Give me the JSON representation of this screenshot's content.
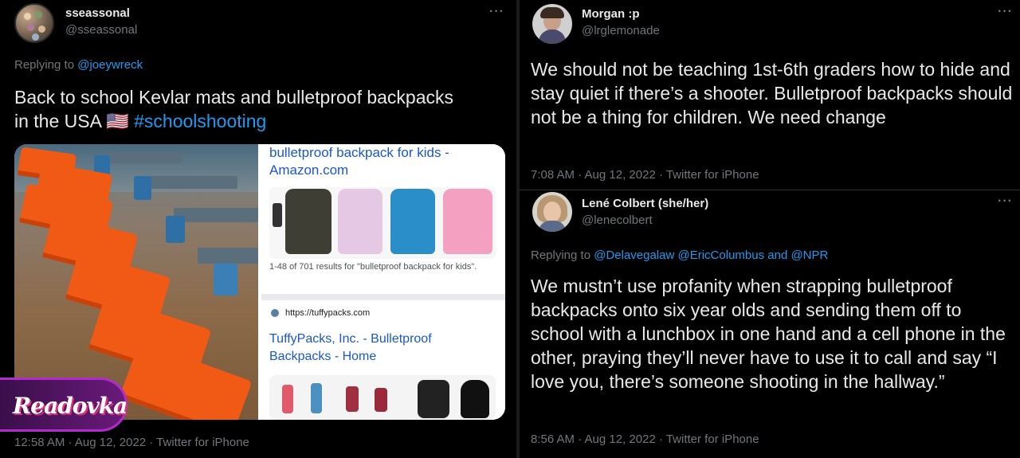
{
  "left_tweet": {
    "display_name": "sseassonal",
    "handle": "@sseassonal",
    "more_label": "···",
    "replying_prefix": "Replying to",
    "replying_to": "@joeywreck",
    "text_line1": "Back to school Kevlar mats and bulletproof backpacks",
    "text_line2_prefix": "in the USA 🇺🇸 ",
    "hashtag": "#schoolshooting",
    "timestamp": "12:58 AM · Aug 12, 2022 · Twitter for iPhone",
    "media": {
      "search_result_1_title": "bulletproof backpack for kids - Amazon.com",
      "search_result_1_count": "1-48 of 701 results for \"bulletproof backpack for kids\".",
      "search_result_2_url": "https://tuffypacks.com",
      "search_result_2_title": "TuffyPacks, Inc. - Bulletproof Backpacks - Home"
    },
    "watermark": "Readovka"
  },
  "right_tweet_1": {
    "display_name": "Morgan :p",
    "handle": "@lrglemonade",
    "more_label": "···",
    "text": "We should not be teaching 1st-6th graders how to hide and stay quiet if there’s a shooter. Bulletproof backpacks should not be a thing for children. We need change",
    "timestamp": "7:08 AM · Aug 12, 2022 · Twitter for iPhone"
  },
  "right_tweet_2": {
    "display_name": "Lené Colbert (she/her)",
    "handle": "@lenecolbert",
    "more_label": "···",
    "replying_prefix": "Replying to",
    "replying_to": "@Delavegalaw @EricColumbus and @NPR",
    "text": "We mustn’t use profanity when strapping bulletproof backpacks onto six year olds and sending them off to school with a lunchbox in one hand and a cell phone in the other, praying they’ll never have to use it to call and say “I love you, there’s someone shooting in the hallway.”",
    "timestamp": "8:56 AM · Aug 12, 2022 · Twitter for iPhone"
  },
  "colors": {
    "background": "#000000",
    "text": "#e7e9ea",
    "muted": "#71767b",
    "link": "#1d9bf0",
    "mat_orange": "#f05a14"
  }
}
